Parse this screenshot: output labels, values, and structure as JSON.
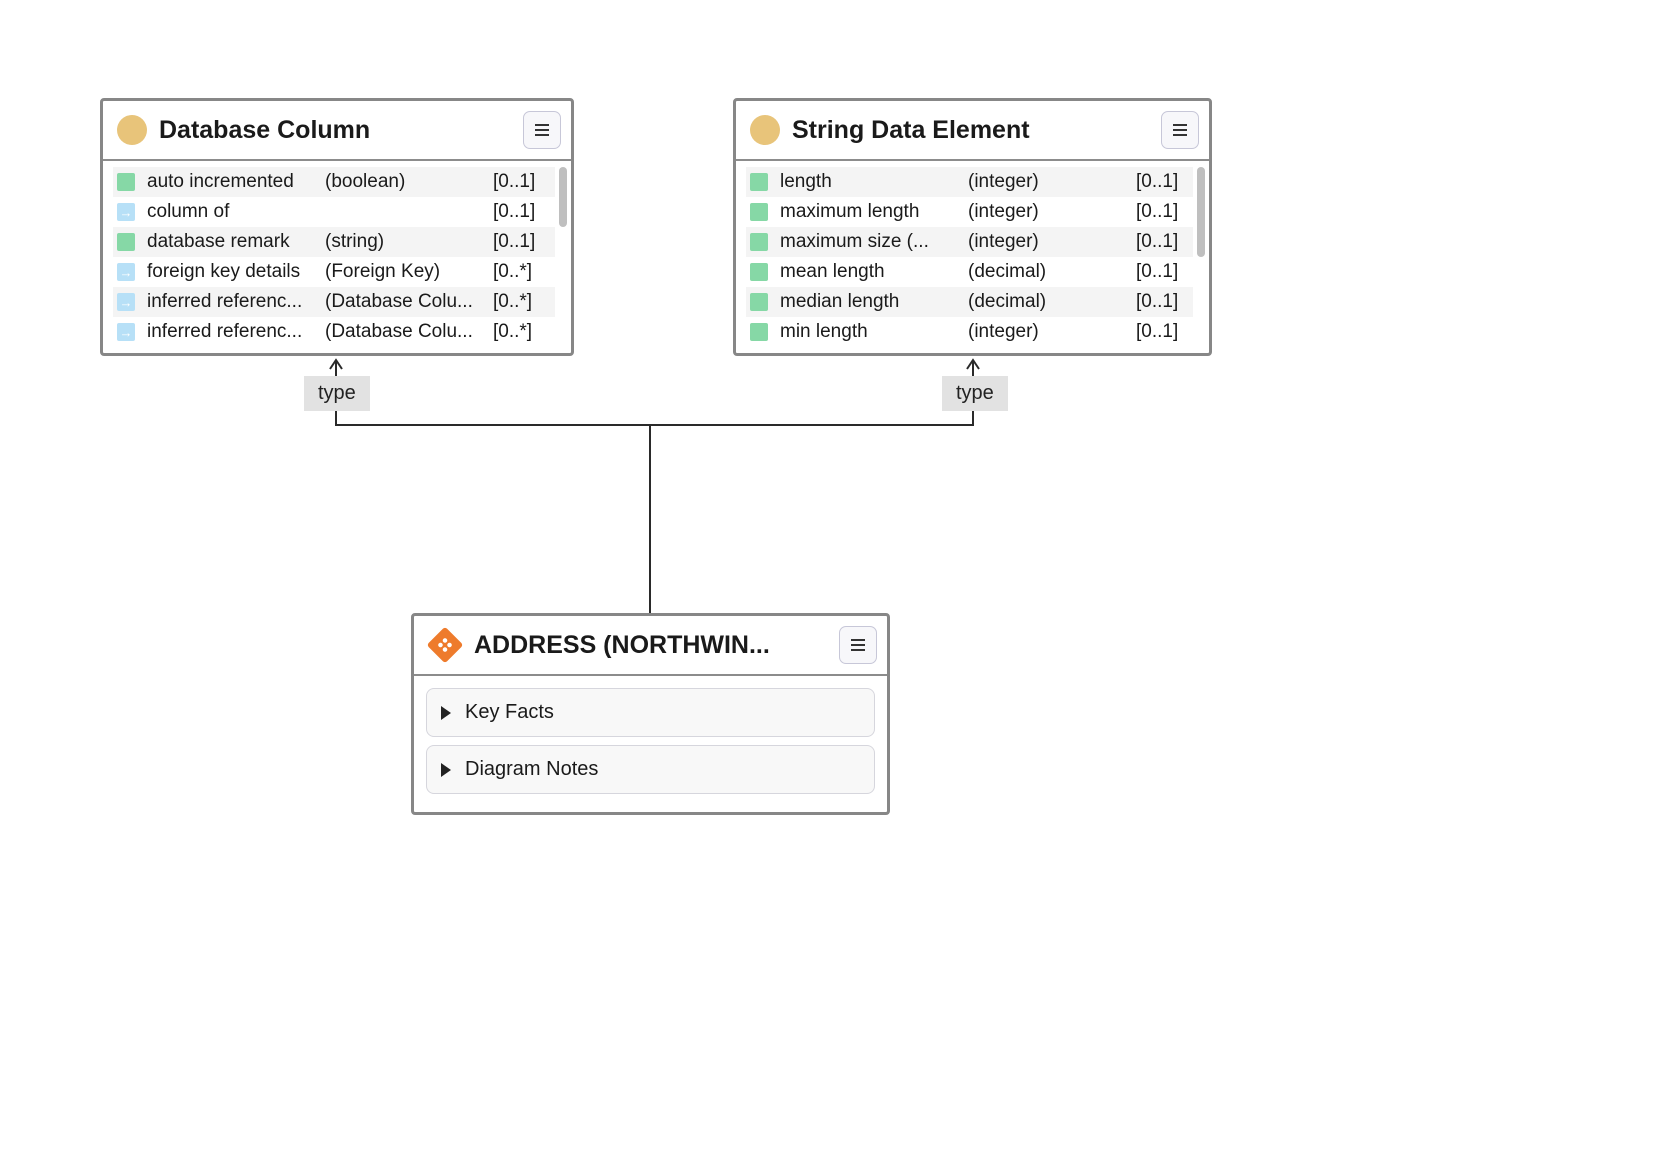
{
  "nodes": {
    "dbcol": {
      "title": "Database Column",
      "attrs": [
        {
          "icon": "green",
          "name": "auto incremented",
          "type": "(boolean)",
          "card": "[0..1]"
        },
        {
          "icon": "blue",
          "name": "column of",
          "type": "",
          "card": "[0..1]"
        },
        {
          "icon": "green",
          "name": "database remark",
          "type": "(string)",
          "card": "[0..1]"
        },
        {
          "icon": "blue",
          "name": "foreign key details",
          "type": "(Foreign Key)",
          "card": "[0..*]"
        },
        {
          "icon": "blue",
          "name": "inferred referenc...",
          "type": "(Database Colu...",
          "card": "[0..*]"
        },
        {
          "icon": "blue",
          "name": "inferred referenc...",
          "type": "(Database Colu...",
          "card": "[0..*]"
        }
      ]
    },
    "strdata": {
      "title": "String Data Element",
      "attrs": [
        {
          "icon": "green",
          "name": "length",
          "type": "(integer)",
          "card": "[0..1]"
        },
        {
          "icon": "green",
          "name": "maximum length",
          "type": "(integer)",
          "card": "[0..1]"
        },
        {
          "icon": "green",
          "name": "maximum size (...",
          "type": "(integer)",
          "card": "[0..1]"
        },
        {
          "icon": "green",
          "name": "mean length",
          "type": "(decimal)",
          "card": "[0..1]"
        },
        {
          "icon": "green",
          "name": "median length",
          "type": "(decimal)",
          "card": "[0..1]"
        },
        {
          "icon": "green",
          "name": "min length",
          "type": "(integer)",
          "card": "[0..1]"
        }
      ]
    },
    "address": {
      "title": "ADDRESS (NORTHWIN...",
      "sections": [
        "Key Facts",
        "Diagram Notes"
      ]
    }
  },
  "edge_labels": {
    "left": "type",
    "right": "type"
  }
}
